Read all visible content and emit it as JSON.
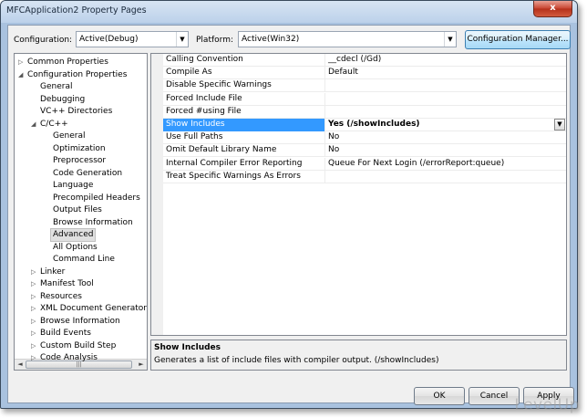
{
  "window": {
    "title": "MFCApplication2 Property Pages",
    "close_glyph": "x"
  },
  "toolbar": {
    "configuration_label": "Configuration:",
    "configuration_value": "Active(Debug)",
    "platform_label": "Platform:",
    "platform_value": "Active(Win32)",
    "config_manager_label": "Configuration Manager..."
  },
  "tree": {
    "items": [
      {
        "label": "Common Properties",
        "expander": "collapsed"
      },
      {
        "label": "Configuration Properties",
        "expander": "expanded"
      },
      {
        "label": "General"
      },
      {
        "label": "Debugging"
      },
      {
        "label": "VC++ Directories"
      },
      {
        "label": "C/C++",
        "expander": "expanded"
      },
      {
        "label": "General"
      },
      {
        "label": "Optimization"
      },
      {
        "label": "Preprocessor"
      },
      {
        "label": "Code Generation"
      },
      {
        "label": "Language"
      },
      {
        "label": "Precompiled Headers"
      },
      {
        "label": "Output Files"
      },
      {
        "label": "Browse Information"
      },
      {
        "label": "Advanced",
        "selected": true
      },
      {
        "label": "All Options"
      },
      {
        "label": "Command Line"
      },
      {
        "label": "Linker",
        "expander": "collapsed"
      },
      {
        "label": "Manifest Tool",
        "expander": "collapsed"
      },
      {
        "label": "Resources",
        "expander": "collapsed"
      },
      {
        "label": "XML Document Generator",
        "expander": "collapsed"
      },
      {
        "label": "Browse Information",
        "expander": "collapsed"
      },
      {
        "label": "Build Events",
        "expander": "collapsed"
      },
      {
        "label": "Custom Build Step",
        "expander": "collapsed"
      },
      {
        "label": "Code Analysis",
        "expander": "collapsed"
      }
    ]
  },
  "grid": {
    "rows": [
      {
        "name": "Calling Convention",
        "value": "__cdecl (/Gd)"
      },
      {
        "name": "Compile As",
        "value": "Default"
      },
      {
        "name": "Disable Specific Warnings",
        "value": ""
      },
      {
        "name": "Forced Include File",
        "value": ""
      },
      {
        "name": "Forced #using File",
        "value": ""
      },
      {
        "name": "Show Includes",
        "value": "Yes (/showIncludes)",
        "selected": true
      },
      {
        "name": "Use Full Paths",
        "value": "No"
      },
      {
        "name": "Omit Default Library Name",
        "value": "No"
      },
      {
        "name": "Internal Compiler Error Reporting",
        "value": "Queue For Next Login (/errorReport:queue)"
      },
      {
        "name": "Treat Specific Warnings As Errors",
        "value": ""
      }
    ]
  },
  "description": {
    "title": "Show Includes",
    "text": "Generates a list of include files with compiler output.     (/showIncludes)"
  },
  "buttons": {
    "ok": "OK",
    "cancel": "Cancel",
    "apply": "Apply"
  },
  "watermark": "LevelUp"
}
